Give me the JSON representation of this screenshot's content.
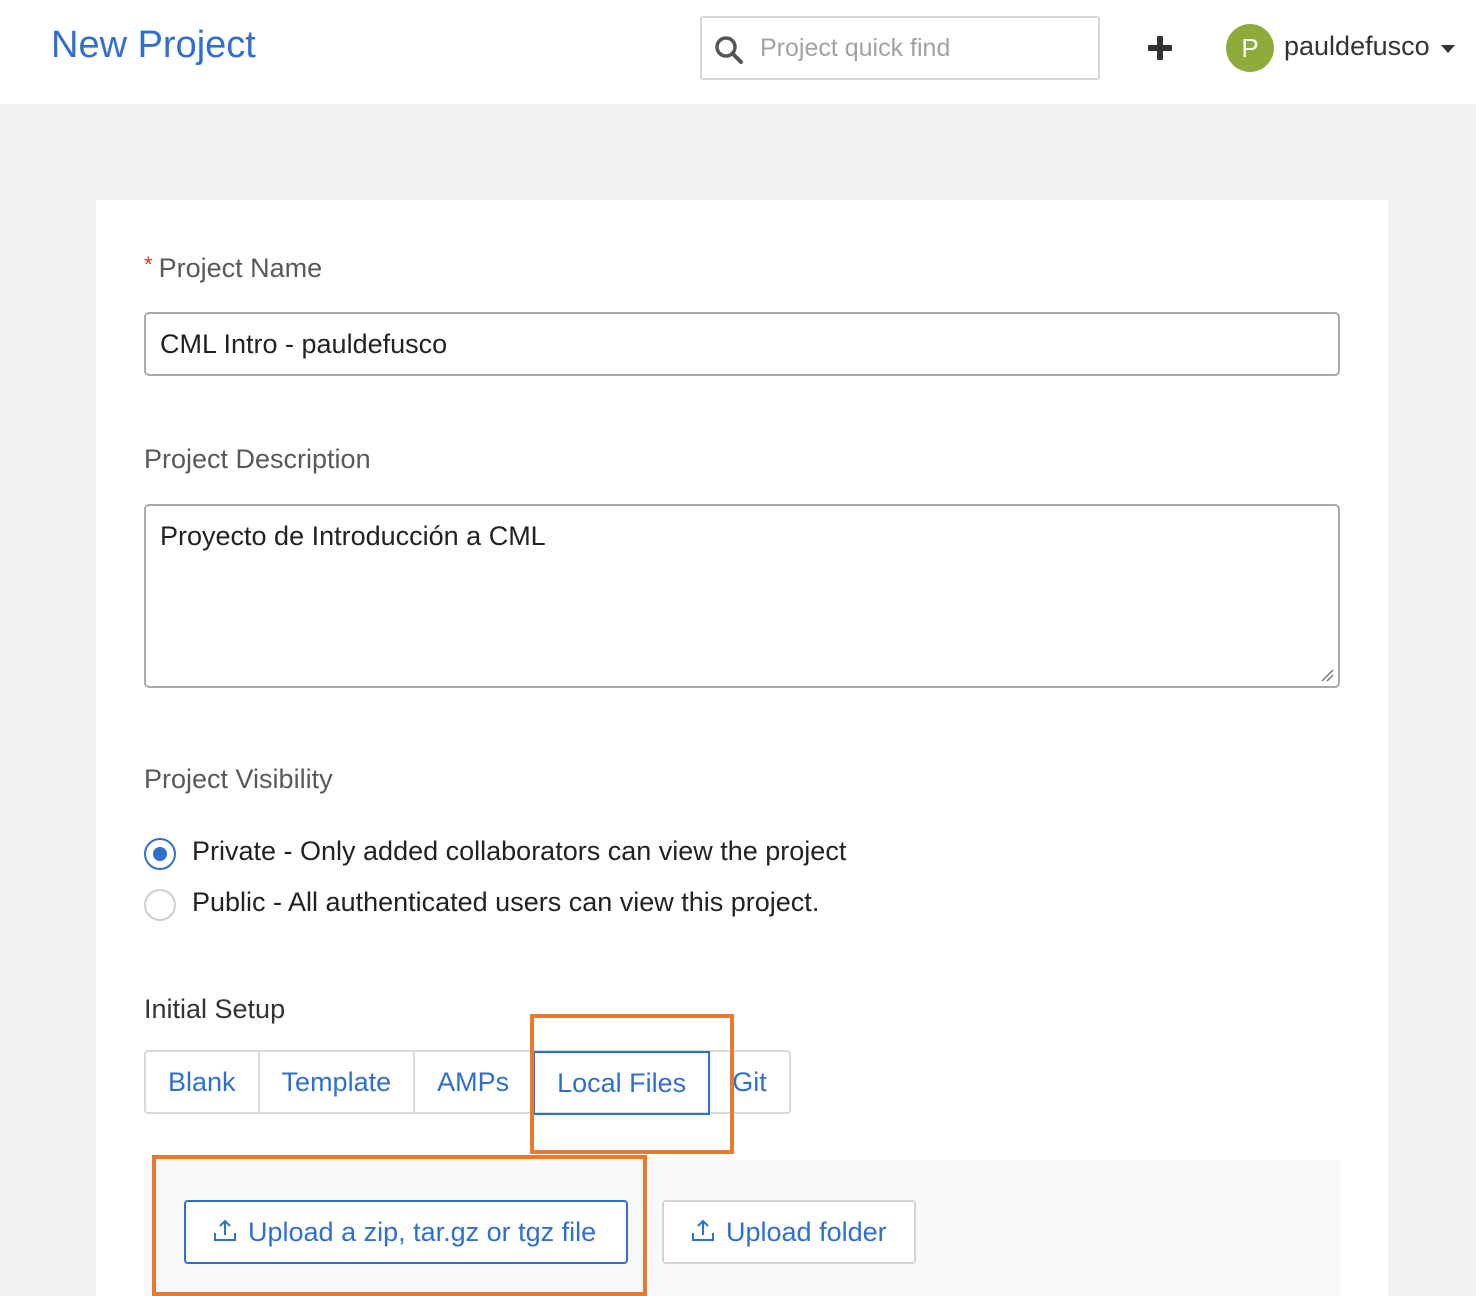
{
  "header": {
    "title": "New Project",
    "search_placeholder": "Project quick find",
    "username": "pauldefusco",
    "avatar_initial": "P",
    "avatar_color": "#8fac3a",
    "accent_color": "#2f6fd1"
  },
  "form": {
    "project_name": {
      "required_mark": "*",
      "label": "Project Name",
      "value": "CML Intro - pauldefusco"
    },
    "project_description": {
      "label": "Project Description",
      "value": "Proyecto de Introducción a CML"
    },
    "visibility": {
      "label": "Project Visibility",
      "options": [
        {
          "label": "Private - Only added collaborators can view the project",
          "selected": true
        },
        {
          "label": "Public - All authenticated users can view this project.",
          "selected": false
        }
      ]
    },
    "initial_setup": {
      "label": "Initial Setup",
      "tabs": [
        "Blank",
        "Template",
        "AMPs",
        "Local Files",
        "Git"
      ],
      "active_tab": "Local Files"
    },
    "upload": {
      "file_button": "Upload a zip, tar.gz or tgz file",
      "folder_button": "Upload folder"
    }
  },
  "annotations": {
    "highlight_color": "#e87a2e"
  }
}
